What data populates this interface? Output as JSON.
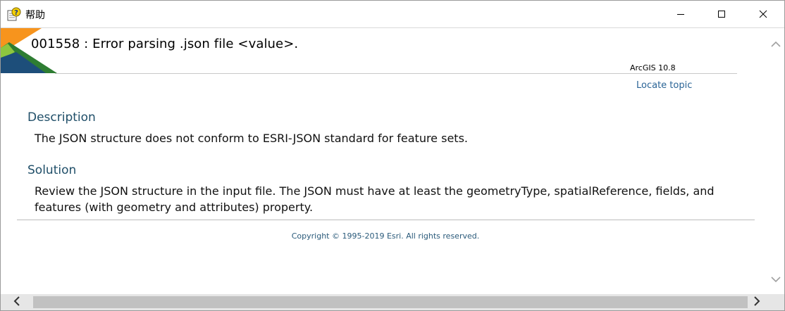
{
  "window": {
    "title": "帮助",
    "controls": [
      "minimize-icon",
      "maximize-icon",
      "close-icon"
    ]
  },
  "topic": {
    "title": "001558 : Error parsing .json file <value>.",
    "version": "ArcGIS 10.8",
    "locate_link": "Locate topic"
  },
  "sections": [
    {
      "heading": "Description",
      "body": "The JSON structure does not conform to ESRI-JSON standard for feature sets."
    },
    {
      "heading": "Solution",
      "body": "Review the JSON structure in the input file. The JSON must have at least the geometryType, spatialReference, fields, and features (with geometry and attributes) property."
    }
  ],
  "footer": {
    "copyright": "Copyright © 1995-2019 Esri. All rights reserved."
  },
  "colors": {
    "heading": "#1f4e68",
    "link": "#2a6496",
    "corner_orange": "#f7941d",
    "corner_green": "#2e7d32",
    "corner_lightgreen": "#8dc63f",
    "corner_blue": "#1d4e7a"
  }
}
